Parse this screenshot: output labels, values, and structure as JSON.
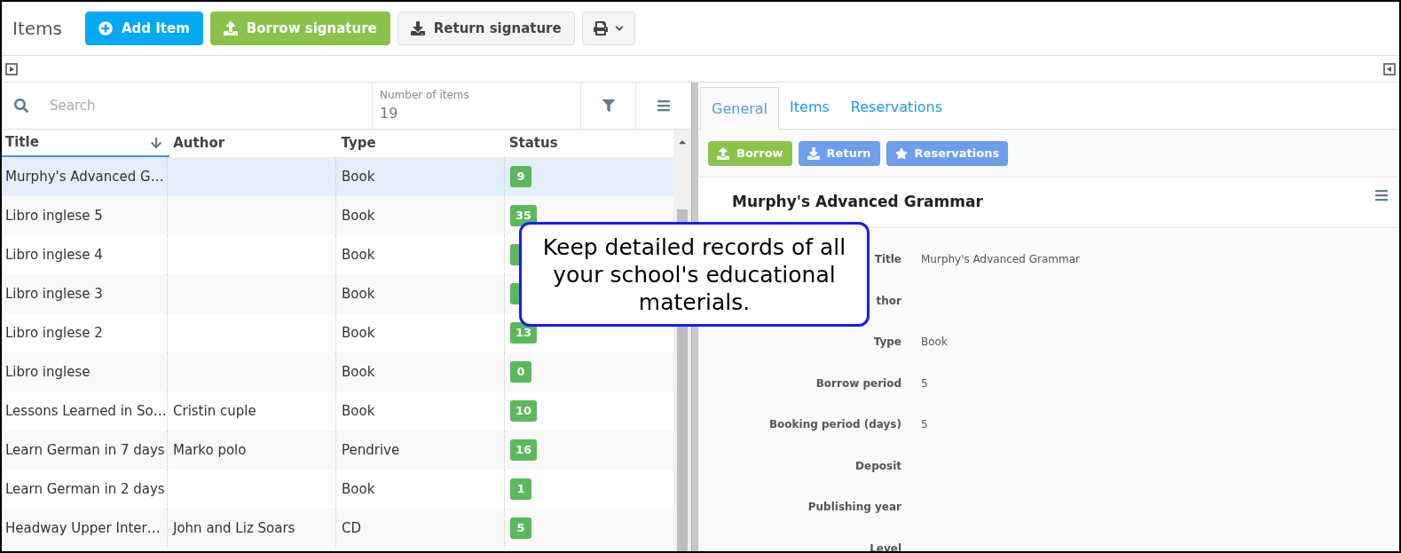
{
  "toolbar": {
    "title": "Items",
    "buttons": [
      {
        "label": "Add Item",
        "kind": "add"
      },
      {
        "label": "Borrow signature",
        "kind": "borrow"
      },
      {
        "label": "Return signature",
        "kind": "return"
      },
      {
        "kind": "print"
      }
    ]
  },
  "search": {
    "placeholder": "Search"
  },
  "count": {
    "label": "Number of items",
    "value": "19"
  },
  "table": {
    "columns": [
      {
        "label": "Title",
        "sorted": true
      },
      {
        "label": "Author",
        "sorted": false
      },
      {
        "label": "Type",
        "sorted": false
      },
      {
        "label": "Status",
        "sorted": false
      }
    ],
    "rows": [
      {
        "title": "Murphy's Advanced G…",
        "author": "",
        "type": "Book",
        "status": "9",
        "selected": true
      },
      {
        "title": "Libro inglese 5",
        "author": "",
        "type": "Book",
        "status": "35",
        "selected": false
      },
      {
        "title": "Libro inglese 4",
        "author": "",
        "type": "Book",
        "selected": false
      },
      {
        "title": "Libro inglese 3",
        "author": "",
        "type": "Book",
        "selected": false
      },
      {
        "title": "Libro inglese 2",
        "author": "",
        "type": "Book",
        "status": "13",
        "selected": false
      },
      {
        "title": "Libro inglese",
        "author": "",
        "type": "Book",
        "status": "0",
        "selected": false
      },
      {
        "title": "Lessons Learned in So…",
        "author": "Cristin cuple",
        "type": "Book",
        "status": "10",
        "selected": false
      },
      {
        "title": "Learn German in 7 days",
        "author": "Marko polo",
        "type": "Pendrive",
        "status": "16",
        "selected": false
      },
      {
        "title": "Learn German in 2 days",
        "author": "",
        "type": "Book",
        "status": "1",
        "selected": false
      },
      {
        "title": "Headway Upper Inter…",
        "author": "John and Liz Soars",
        "type": "CD",
        "status": "5",
        "selected": false
      }
    ]
  },
  "detail": {
    "tabs": [
      {
        "label": "General",
        "selected": true
      },
      {
        "label": "Items",
        "selected": false
      },
      {
        "label": "Reservations",
        "selected": false
      }
    ],
    "actions": [
      {
        "label": "Borrow",
        "kind": "borrow"
      },
      {
        "label": "Return",
        "kind": "return"
      },
      {
        "label": "Reservations",
        "kind": "reserve"
      }
    ],
    "heading": "Murphy's Advanced Grammar",
    "fields": [
      {
        "label": "Title",
        "value": "Murphy's Advanced Grammar"
      },
      {
        "label": "thor"
      },
      {
        "label": "Type",
        "value": "Book"
      },
      {
        "label": "Borrow period",
        "value": "5"
      },
      {
        "label": "Booking period (days)",
        "value": "5"
      },
      {
        "label": "Deposit"
      },
      {
        "label": "Publishing year"
      },
      {
        "label": "Level"
      }
    ]
  },
  "callout": {
    "text": "Keep detailed records of all your school's educational materials."
  }
}
